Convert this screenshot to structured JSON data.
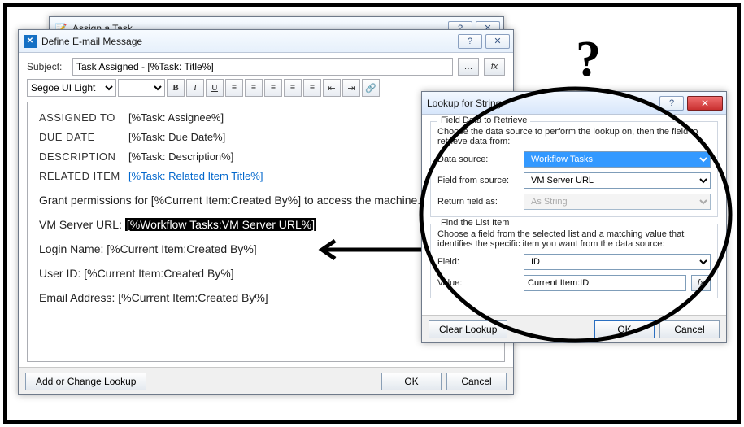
{
  "assign": {
    "title": "Assign a Task",
    "help": "?",
    "close": "✕"
  },
  "email": {
    "title": "Define E-mail Message",
    "help": "?",
    "close": "✕",
    "subjectLabel": "Subject:",
    "subjectValue": "Task Assigned - [%Task: Title%]",
    "moreBtn": "…",
    "fxBtn": "fx",
    "font": "Segoe UI Light",
    "tb": {
      "b": "B",
      "i": "I",
      "u": "U"
    },
    "msg": {
      "assignedLab": "ASSIGNED TO",
      "assigned": "[%Task: Assignee%]",
      "dueLab": "DUE DATE",
      "due": "[%Task: Due Date%]",
      "descLab": "DESCRIPTION",
      "desc": "[%Task: Description%]",
      "relLab": "RELATED ITEM",
      "rel": "[%Task: Related Item Title%]",
      "grant": "Grant permissions for [%Current Item:Created By%] to access the machine.",
      "vmLab": "VM Server URL: ",
      "vm": "[%Workflow Tasks:VM Server URL%]",
      "loginLab": "Login Name: ",
      "login": "[%Current Item:Created By%]",
      "uidLab": "User ID: ",
      "uid": "[%Current Item:Created By%]",
      "emailLab": "Email Address: ",
      "email": "[%Current Item:Created By%]"
    },
    "addLookup": "Add or Change Lookup",
    "ok": "OK",
    "cancel": "Cancel"
  },
  "lookup": {
    "title": "Lookup for String",
    "help": "?",
    "close": "✕",
    "g1": {
      "legend": "Field Data to Retrieve",
      "hint": "Choose the data source to perform the lookup on, then the field to retrieve data from:",
      "dsLab": "Data source:",
      "ds": "Workflow Tasks",
      "ffLab": "Field from source:",
      "ff": "VM Server URL",
      "rfLab": "Return field as:",
      "rf": "As String"
    },
    "g2": {
      "legend": "Find the List Item",
      "hint": "Choose a field from the selected list and a matching value that identifies the specific item you want from the data source:",
      "fLab": "Field:",
      "f": "ID",
      "vLab": "Value:",
      "v": "Current Item:ID"
    },
    "clear": "Clear Lookup",
    "ok": "OK",
    "cancel": "Cancel",
    "fx": "fx"
  },
  "annot": {
    "q": "?"
  }
}
